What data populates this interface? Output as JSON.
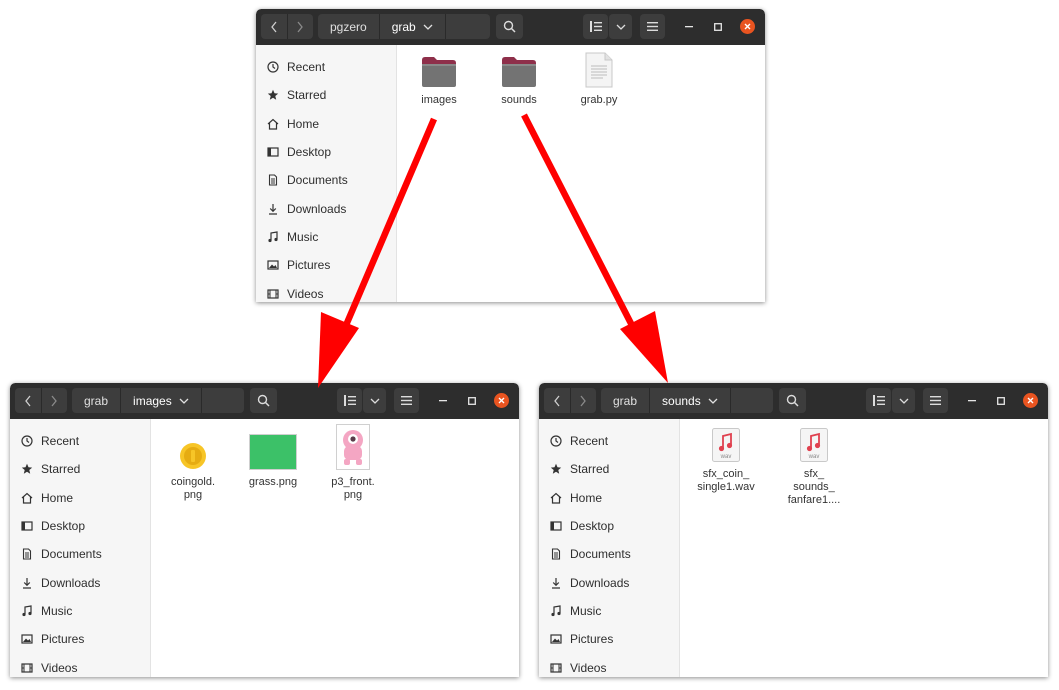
{
  "sidebar": {
    "items": [
      {
        "label": "Recent",
        "icon": "clock-icon"
      },
      {
        "label": "Starred",
        "icon": "star-icon"
      },
      {
        "label": "Home",
        "icon": "home-icon"
      },
      {
        "label": "Desktop",
        "icon": "desktop-icon"
      },
      {
        "label": "Documents",
        "icon": "document-icon"
      },
      {
        "label": "Downloads",
        "icon": "download-icon"
      },
      {
        "label": "Music",
        "icon": "music-icon"
      },
      {
        "label": "Pictures",
        "icon": "pictures-icon"
      },
      {
        "label": "Videos",
        "icon": "video-icon"
      }
    ]
  },
  "windows": {
    "top": {
      "path": [
        "pgzero",
        "grab"
      ],
      "files": [
        {
          "name": "images",
          "type": "folder"
        },
        {
          "name": "sounds",
          "type": "folder"
        },
        {
          "name": "grab.py",
          "type": "text-file"
        }
      ]
    },
    "left": {
      "path": [
        "grab",
        "images"
      ],
      "files": [
        {
          "name_l1": "coingold.",
          "name_l2": "png",
          "type": "coin-image"
        },
        {
          "name_l1": "grass.png",
          "name_l2": "",
          "type": "grass-image"
        },
        {
          "name_l1": "p3_front.",
          "name_l2": "png",
          "type": "alien-image"
        }
      ]
    },
    "right": {
      "path": [
        "grab",
        "sounds"
      ],
      "files": [
        {
          "name_l1": "sfx_coin_",
          "name_l2": "single1.wav",
          "name_l3": "",
          "badge": "wav",
          "type": "audio-file"
        },
        {
          "name_l1": "sfx_",
          "name_l2": "sounds_",
          "name_l3": "fanfare1....",
          "badge": "wav",
          "type": "audio-file"
        }
      ]
    }
  },
  "colors": {
    "headerbar": "#2d2d2d",
    "button": "#3d3d3d",
    "close": "#e95420",
    "folder": "#737373",
    "folder_tab": "#8e2f4a",
    "arrow": "#ff0000",
    "grass": "#3cc168",
    "coin": "#f7c527",
    "alien": "#f4a6c3"
  }
}
